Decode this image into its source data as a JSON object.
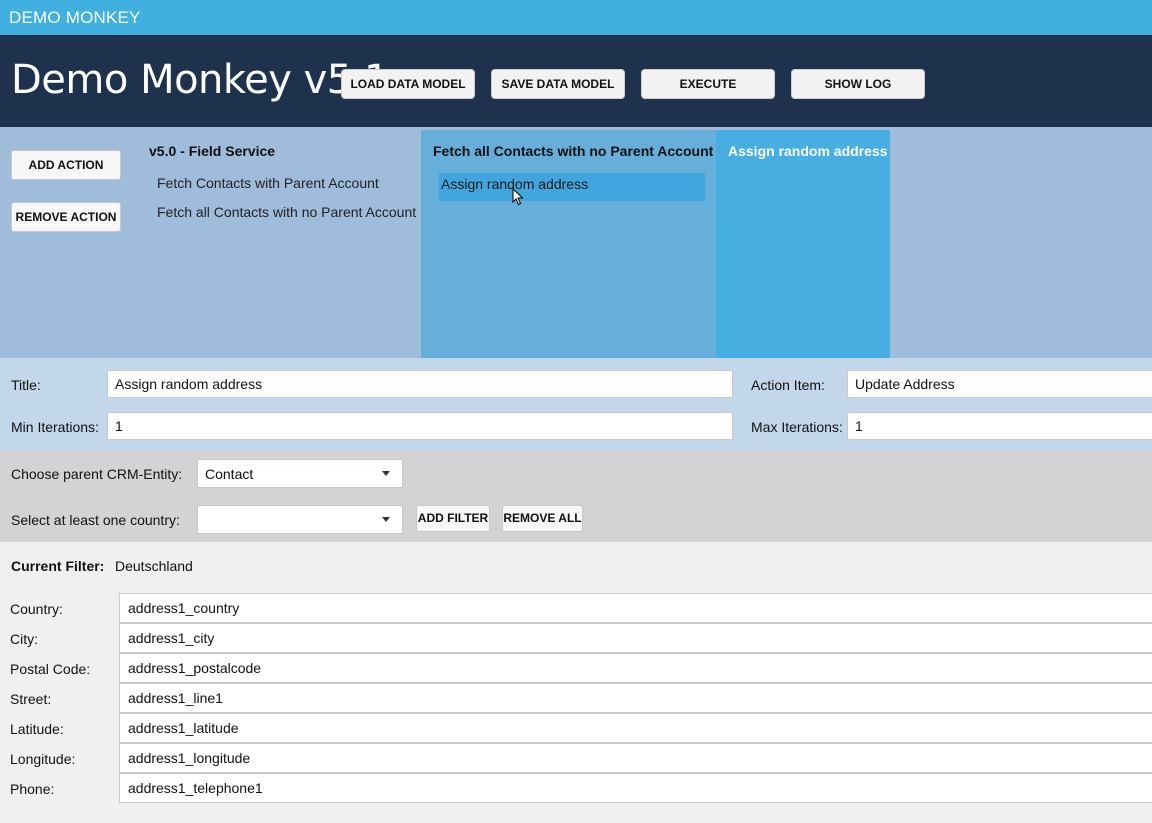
{
  "window": {
    "title": "DEMO MONKEY"
  },
  "header": {
    "app_title": "Demo Monkey v5.1",
    "buttons": {
      "load": "LOAD DATA MODEL",
      "save": "SAVE DATA MODEL",
      "execute": "EXECUTE",
      "show_log": "SHOW LOG"
    }
  },
  "actions": {
    "add_label": "ADD ACTION",
    "remove_label": "REMOVE ACTION",
    "column1": {
      "heading": "v5.0 - Field Service",
      "items": [
        "Fetch Contacts with Parent Account",
        "Fetch all Contacts with no Parent Account"
      ]
    },
    "column2": {
      "heading": "Fetch all Contacts with no Parent Account",
      "items": [
        "Assign random address"
      ]
    },
    "column3": {
      "heading": "Assign random address"
    }
  },
  "properties": {
    "title_label": "Title:",
    "title_value": "Assign random address",
    "action_item_label": "Action Item:",
    "action_item_value": "Update Address",
    "min_label": "Min Iterations:",
    "min_value": "1",
    "max_label": "Max Iterations:",
    "max_value": "1"
  },
  "filters": {
    "parent_label": "Choose parent CRM-Entity:",
    "parent_value": "Contact",
    "country_label": "Select at least one country:",
    "country_value": "",
    "add_filter": "ADD FILTER",
    "remove_all": "REMOVE ALL",
    "current_label": "Current Filter:",
    "current_value": "Deutschland"
  },
  "mapping": [
    {
      "label": "Country:",
      "value": "address1_country"
    },
    {
      "label": "City:",
      "value": "address1_city"
    },
    {
      "label": "Postal Code:",
      "value": "address1_postalcode"
    },
    {
      "label": "Street:",
      "value": "address1_line1"
    },
    {
      "label": "Latitude:",
      "value": "address1_latitude"
    },
    {
      "label": "Longitude:",
      "value": "address1_longitude"
    },
    {
      "label": "Phone:",
      "value": "address1_telephone1"
    }
  ]
}
